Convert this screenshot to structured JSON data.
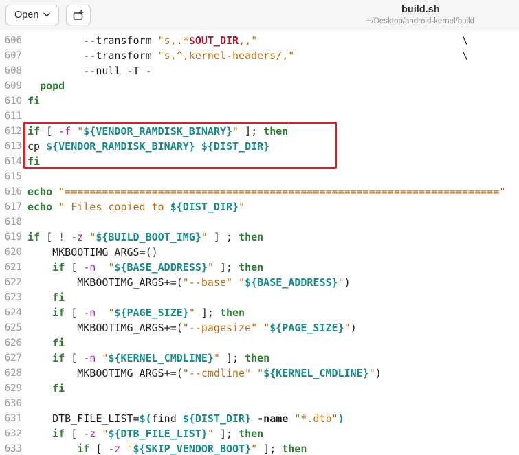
{
  "header": {
    "open_button_label": "Open",
    "title": "build.sh",
    "subtitle": "~/Desktop/android-kernel/build"
  },
  "colors": {
    "keyword": "#2e7d32",
    "string": "#c36c09",
    "variable": "#148c8c",
    "operator": "#9c27b0",
    "string_variable": "#a51d2d",
    "annotation_box": "#e01b24",
    "header_background": "#f6f6f6",
    "line_number": "#9d9d9d"
  },
  "annotation": {
    "highlighted_lines": "612-614"
  },
  "editor": {
    "language": "shell",
    "first_line": 606,
    "last_line": 633,
    "lines": [
      {
        "num": "606",
        "tokens": [
          [
            "p",
            "         --transform "
          ],
          [
            "s",
            "\"s,.*"
          ],
          [
            "e",
            "$OUT_DIR"
          ],
          [
            "s",
            ",,\""
          ],
          [
            "p",
            "                                 \\"
          ]
        ]
      },
      {
        "num": "607",
        "tokens": [
          [
            "p",
            "         --transform "
          ],
          [
            "s",
            "\"s,^,kernel-headers/,\""
          ],
          [
            "p",
            "                           \\"
          ]
        ]
      },
      {
        "num": "608",
        "tokens": [
          [
            "p",
            "         --null -T -"
          ]
        ]
      },
      {
        "num": "609",
        "tokens": [
          [
            "p",
            "  "
          ],
          [
            "k",
            "popd"
          ]
        ]
      },
      {
        "num": "610",
        "tokens": [
          [
            "k",
            "fi"
          ]
        ]
      },
      {
        "num": "611",
        "tokens": []
      },
      {
        "num": "612",
        "tokens": [
          [
            "k",
            "if"
          ],
          [
            "p",
            " [ "
          ],
          [
            "o",
            "-f"
          ],
          [
            "p",
            " "
          ],
          [
            "s",
            "\""
          ],
          [
            "v",
            "${VENDOR_RAMDISK_BINARY}"
          ],
          [
            "s",
            "\""
          ],
          [
            "p",
            " ]; "
          ],
          [
            "k",
            "then"
          ],
          [
            "caret",
            ""
          ]
        ]
      },
      {
        "num": "613",
        "tokens": [
          [
            "p",
            "cp "
          ],
          [
            "v",
            "${VENDOR_RAMDISK_BINARY}"
          ],
          [
            "p",
            " "
          ],
          [
            "v",
            "${DIST_DIR}"
          ]
        ]
      },
      {
        "num": "614",
        "tokens": [
          [
            "k",
            "fi"
          ]
        ]
      },
      {
        "num": "615",
        "tokens": []
      },
      {
        "num": "616",
        "tokens": [
          [
            "k",
            "echo"
          ],
          [
            "p",
            " "
          ],
          [
            "s",
            "\"======================================================================\""
          ]
        ]
      },
      {
        "num": "617",
        "tokens": [
          [
            "k",
            "echo"
          ],
          [
            "p",
            " "
          ],
          [
            "s",
            "\" Files copied to "
          ],
          [
            "v",
            "${DIST_DIR}"
          ],
          [
            "s",
            "\""
          ]
        ]
      },
      {
        "num": "618",
        "tokens": []
      },
      {
        "num": "619",
        "tokens": [
          [
            "k",
            "if"
          ],
          [
            "p",
            " [ "
          ],
          [
            "o",
            "!"
          ],
          [
            "p",
            " "
          ],
          [
            "o",
            "-z"
          ],
          [
            "p",
            " "
          ],
          [
            "s",
            "\""
          ],
          [
            "v",
            "${BUILD_BOOT_IMG}"
          ],
          [
            "s",
            "\""
          ],
          [
            "p",
            " ] ; "
          ],
          [
            "k",
            "then"
          ]
        ]
      },
      {
        "num": "620",
        "tokens": [
          [
            "p",
            "    MKBOOTIMG_ARGS=()"
          ]
        ]
      },
      {
        "num": "621",
        "tokens": [
          [
            "p",
            "    "
          ],
          [
            "k",
            "if"
          ],
          [
            "p",
            " [ "
          ],
          [
            "o",
            "-n"
          ],
          [
            "p",
            "  "
          ],
          [
            "s",
            "\""
          ],
          [
            "v",
            "${BASE_ADDRESS}"
          ],
          [
            "s",
            "\""
          ],
          [
            "p",
            " ]; "
          ],
          [
            "k",
            "then"
          ]
        ]
      },
      {
        "num": "622",
        "tokens": [
          [
            "p",
            "        MKBOOTIMG_ARGS+=("
          ],
          [
            "s",
            "\"--base\""
          ],
          [
            "p",
            " "
          ],
          [
            "s",
            "\""
          ],
          [
            "v",
            "${BASE_ADDRESS}"
          ],
          [
            "s",
            "\""
          ],
          [
            "p",
            ")"
          ]
        ]
      },
      {
        "num": "623",
        "tokens": [
          [
            "p",
            "    "
          ],
          [
            "k",
            "fi"
          ]
        ]
      },
      {
        "num": "624",
        "tokens": [
          [
            "p",
            "    "
          ],
          [
            "k",
            "if"
          ],
          [
            "p",
            " [ "
          ],
          [
            "o",
            "-n"
          ],
          [
            "p",
            "  "
          ],
          [
            "s",
            "\""
          ],
          [
            "v",
            "${PAGE_SIZE}"
          ],
          [
            "s",
            "\""
          ],
          [
            "p",
            " ]; "
          ],
          [
            "k",
            "then"
          ]
        ]
      },
      {
        "num": "625",
        "tokens": [
          [
            "p",
            "        MKBOOTIMG_ARGS+=("
          ],
          [
            "s",
            "\"--pagesize\""
          ],
          [
            "p",
            " "
          ],
          [
            "s",
            "\""
          ],
          [
            "v",
            "${PAGE_SIZE}"
          ],
          [
            "s",
            "\""
          ],
          [
            "p",
            ")"
          ]
        ]
      },
      {
        "num": "626",
        "tokens": [
          [
            "p",
            "    "
          ],
          [
            "k",
            "fi"
          ]
        ]
      },
      {
        "num": "627",
        "tokens": [
          [
            "p",
            "    "
          ],
          [
            "k",
            "if"
          ],
          [
            "p",
            " [ "
          ],
          [
            "o",
            "-n"
          ],
          [
            "p",
            " "
          ],
          [
            "s",
            "\""
          ],
          [
            "v",
            "${KERNEL_CMDLINE}"
          ],
          [
            "s",
            "\""
          ],
          [
            "p",
            " ]; "
          ],
          [
            "k",
            "then"
          ]
        ]
      },
      {
        "num": "628",
        "tokens": [
          [
            "p",
            "        MKBOOTIMG_ARGS+=("
          ],
          [
            "s",
            "\"--cmdline\""
          ],
          [
            "p",
            " "
          ],
          [
            "s",
            "\""
          ],
          [
            "v",
            "${KERNEL_CMDLINE}"
          ],
          [
            "s",
            "\""
          ],
          [
            "p",
            ")"
          ]
        ]
      },
      {
        "num": "629",
        "tokens": [
          [
            "p",
            "    "
          ],
          [
            "k",
            "fi"
          ]
        ]
      },
      {
        "num": "630",
        "tokens": []
      },
      {
        "num": "631",
        "tokens": [
          [
            "p",
            "    DTB_FILE_LIST="
          ],
          [
            "v",
            "$("
          ],
          [
            "p",
            "find "
          ],
          [
            "v",
            "${DIST_DIR}"
          ],
          [
            "p",
            " "
          ],
          [
            "b",
            "-name"
          ],
          [
            "p",
            " "
          ],
          [
            "s",
            "\"*.dtb\""
          ],
          [
            "v",
            ")"
          ]
        ]
      },
      {
        "num": "632",
        "tokens": [
          [
            "p",
            "    "
          ],
          [
            "k",
            "if"
          ],
          [
            "p",
            " [ "
          ],
          [
            "o",
            "-z"
          ],
          [
            "p",
            " "
          ],
          [
            "s",
            "\""
          ],
          [
            "v",
            "${DTB_FILE_LIST}"
          ],
          [
            "s",
            "\""
          ],
          [
            "p",
            " ]; "
          ],
          [
            "k",
            "then"
          ]
        ]
      },
      {
        "num": "633",
        "tokens": [
          [
            "p",
            "        "
          ],
          [
            "k",
            "if"
          ],
          [
            "p",
            " [ "
          ],
          [
            "o",
            "-z"
          ],
          [
            "p",
            " "
          ],
          [
            "s",
            "\""
          ],
          [
            "v",
            "${SKIP_VENDOR_BOOT}"
          ],
          [
            "s",
            "\""
          ],
          [
            "p",
            " ]; "
          ],
          [
            "k",
            "then"
          ]
        ]
      }
    ]
  }
}
